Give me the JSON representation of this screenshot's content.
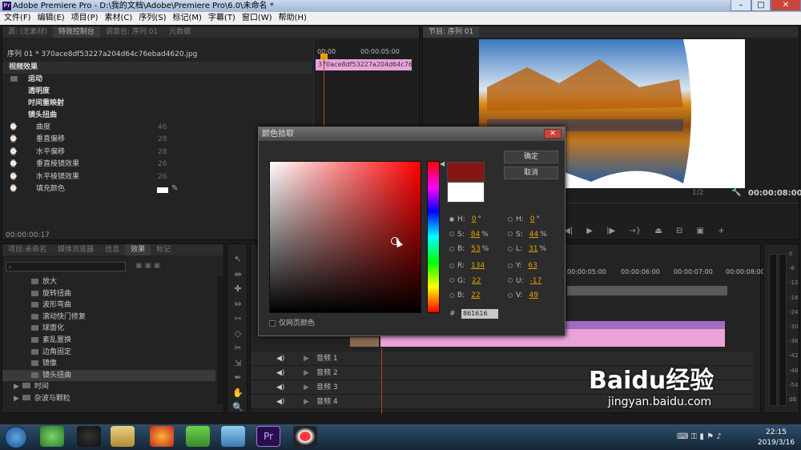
{
  "window": {
    "title": "Adobe Premiere Pro - D:\\我的文档\\Adobe\\Premiere Pro\\6.0\\未命名 *"
  },
  "menu": [
    "文件(F)",
    "编辑(E)",
    "项目(P)",
    "素材(C)",
    "序列(S)",
    "标记(M)",
    "字幕(T)",
    "窗口(W)",
    "帮助(H)"
  ],
  "source_panel": {
    "tabs": [
      "源: (无素材)",
      "特效控制台",
      "调音台: 序列 01",
      "元数据"
    ],
    "clip_path": "序列 01 * 370ace8df53227a204d64c76ebad4620.jpg",
    "clip_short": "370ace8df53227a204d64c76ebad",
    "time_start": "00:00",
    "time_end": "00:00:05:00",
    "section": "视频效果",
    "effects": [
      "运动",
      "透明度",
      "时间重映射",
      "镜头扭曲"
    ],
    "params": [
      {
        "name": "曲度",
        "value": "46"
      },
      {
        "name": "垂直偏移",
        "value": "28"
      },
      {
        "name": "水平偏移",
        "value": "28"
      },
      {
        "name": "垂直棱镜效果",
        "value": "26"
      },
      {
        "name": "水平棱镜效果",
        "value": "26"
      },
      {
        "name": "填充颜色",
        "value": ""
      }
    ],
    "timecode": "00:00:00:17"
  },
  "program_panel": {
    "tab": "节目: 序列 01",
    "fraction": "1/2",
    "timecode": "00:00:08:00"
  },
  "project_panel": {
    "tabs": [
      "项目:未命名",
      "媒体浏览器",
      "信息",
      "效果",
      "标记"
    ],
    "items": [
      "放大",
      "旋转扭曲",
      "波形弯曲",
      "滚动快门修复",
      "球面化",
      "紊乱置换",
      "边角固定",
      "镜像",
      "镜头扭曲"
    ],
    "folders": [
      "时间",
      "杂波与颗粒"
    ]
  },
  "timeline": {
    "ruler": [
      "00:00:05:00",
      "00:00:06:00",
      "00:00:07:00",
      "00:00:08:00"
    ],
    "audio_tracks": [
      "音频 1",
      "音频 2",
      "音频 3",
      "音频 4"
    ]
  },
  "meter": {
    "labels": [
      "0",
      "-6",
      "-12",
      "-18",
      "-24",
      "-30",
      "-36",
      "-42",
      "-48",
      "-54",
      "dB"
    ]
  },
  "color_dialog": {
    "title": "颜色拾取",
    "ok": "确定",
    "cancel": "取消",
    "web_only": "仅网页颜色",
    "hex_label": "#",
    "hex": "861616",
    "selected_color": "#861616",
    "hsb": [
      {
        "k": "H:",
        "v": "0",
        "u": "°"
      },
      {
        "k": "S:",
        "v": "84",
        "u": "%"
      },
      {
        "k": "B:",
        "v": "53",
        "u": "%"
      }
    ],
    "hsl": [
      {
        "k": "H:",
        "v": "0",
        "u": "°"
      },
      {
        "k": "S:",
        "v": "44",
        "u": "%"
      },
      {
        "k": "L:",
        "v": "31",
        "u": "%"
      }
    ],
    "rgb": [
      {
        "k": "R:",
        "v": "134"
      },
      {
        "k": "G:",
        "v": "22"
      },
      {
        "k": "B:",
        "v": "22"
      }
    ],
    "yuv": [
      {
        "k": "Y:",
        "v": "63"
      },
      {
        "k": "U:",
        "v": "-17"
      },
      {
        "k": "V:",
        "v": "49"
      }
    ]
  },
  "watermark": {
    "brand": "Baidu经验",
    "url": "jingyan.baidu.com"
  },
  "taskbar": {
    "time": "22:15",
    "date": "2019/3/16"
  }
}
